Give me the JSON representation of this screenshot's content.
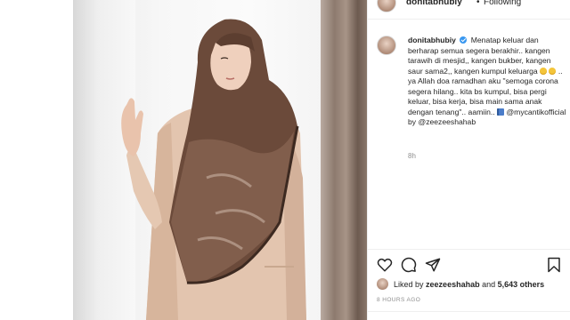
{
  "post": {
    "username": "donitabhubiy",
    "separator": "•",
    "follow_status": "Following"
  },
  "caption": {
    "username": "donitabhubiy",
    "part1": "Menatap keluar dan berharap semua segera berakhir.. kangen tarawih di mesjid,, kangen bukber, kangen saur sama2,, kangen kumpul keluarga",
    "part2": ".. ya Allah doa ramadhan aku \"semoga corona segera hilang.. kita bs kumpul, bisa pergi keluar, bisa kerja, bisa main sama anak dengan tenang\".. aamiin..",
    "mention": "@mycantikofficial",
    "by": "by",
    "credit": "@zeezeeshahab",
    "relative_time": "8h"
  },
  "likes": {
    "prefix": "Liked by",
    "user": "zeezeeshahab",
    "and": "and",
    "count": "5,643 others"
  },
  "timestamp": "8 HOURS AGO",
  "icons": [
    "heart-icon",
    "comment-icon",
    "share-icon",
    "bookmark-icon",
    "verified-badge-icon"
  ],
  "colors": {
    "verified": "#3897f0",
    "muted_text": "#8e8e8e",
    "text": "#262626",
    "scarf": "#6b4a3a",
    "blazer": "#e2c4ae"
  }
}
